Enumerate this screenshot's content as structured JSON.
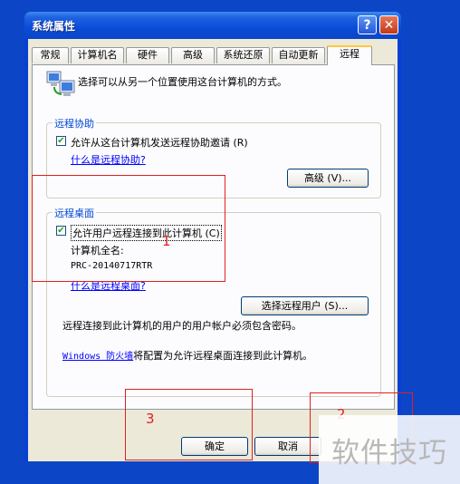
{
  "window": {
    "title": "系统属性"
  },
  "tabs": [
    {
      "label": "常规"
    },
    {
      "label": "计算机名"
    },
    {
      "label": "硬件"
    },
    {
      "label": "高级"
    },
    {
      "label": "系统还原"
    },
    {
      "label": "自动更新"
    },
    {
      "label": "远程"
    }
  ],
  "intro": "选择可以从另一个位置使用这台计算机的方式。",
  "remote_assistance": {
    "heading": "远程协助",
    "checkbox_label": "允许从这台计算机发送远程协助邀请 (R)",
    "link": "什么是远程协助?",
    "advanced_button": "高级 (V)..."
  },
  "remote_desktop": {
    "heading": "远程桌面",
    "checkbox_label": "允许用户远程连接到此计算机 (C)",
    "full_name_label": "计算机全名:",
    "full_name_value": "PRC-20140717RTR",
    "link": "什么是远程桌面?",
    "select_users_button": "选择远程用户 (S)...",
    "note": "远程连接到此计算机的用户的用户帐户必须包含密码。",
    "firewall_link": "Windows 防火墙",
    "firewall_text": "将配置为允许远程桌面连接到此计算机。"
  },
  "footer": {
    "ok": "确定",
    "cancel": "取消"
  },
  "annotations": [
    "1",
    "3",
    "2"
  ],
  "watermark": "软件技巧",
  "colors": {
    "desktop": "#0c46c6",
    "annotation": "#e02020",
    "group_label": "#0046d5"
  }
}
